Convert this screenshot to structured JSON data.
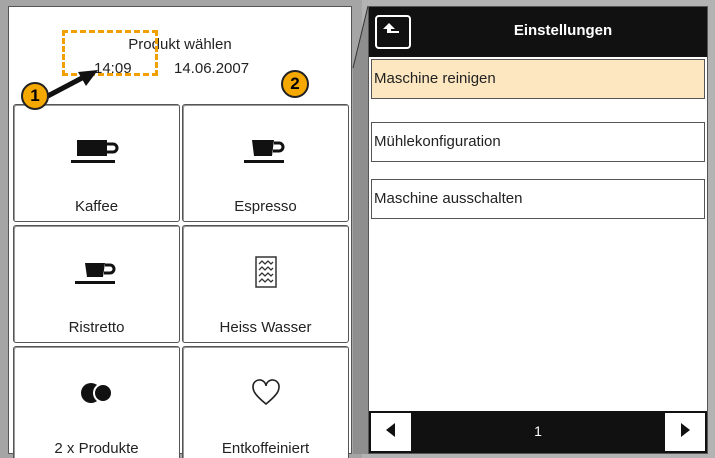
{
  "left_screen": {
    "title": "Produkt wählen",
    "time": "14:09",
    "date": "14.06.2007",
    "callout_number": "1",
    "products": [
      {
        "label": "Kaffee",
        "icon": "coffee-cup-large-icon"
      },
      {
        "label": "Espresso",
        "icon": "espresso-cup-icon"
      },
      {
        "label": "Ristretto",
        "icon": "ristretto-cup-icon"
      },
      {
        "label": "Heiss Wasser",
        "icon": "hot-water-icon"
      },
      {
        "label": "2 x Produkte",
        "icon": "double-product-icon"
      },
      {
        "label": "Entkoffeiniert",
        "icon": "heart-icon"
      }
    ]
  },
  "right_screen": {
    "title": "Einstellungen",
    "back_icon": "back-arrow-icon",
    "callout_number": "2",
    "menu": [
      {
        "label": "Maschine reinigen",
        "active": true
      },
      {
        "label": "Mühlekonfiguration",
        "active": false
      },
      {
        "label": "Maschine ausschalten",
        "active": false
      }
    ],
    "page": "1"
  },
  "colors": {
    "accent": "#f5a800",
    "highlight": "#fde7c0",
    "bar": "#111111"
  }
}
